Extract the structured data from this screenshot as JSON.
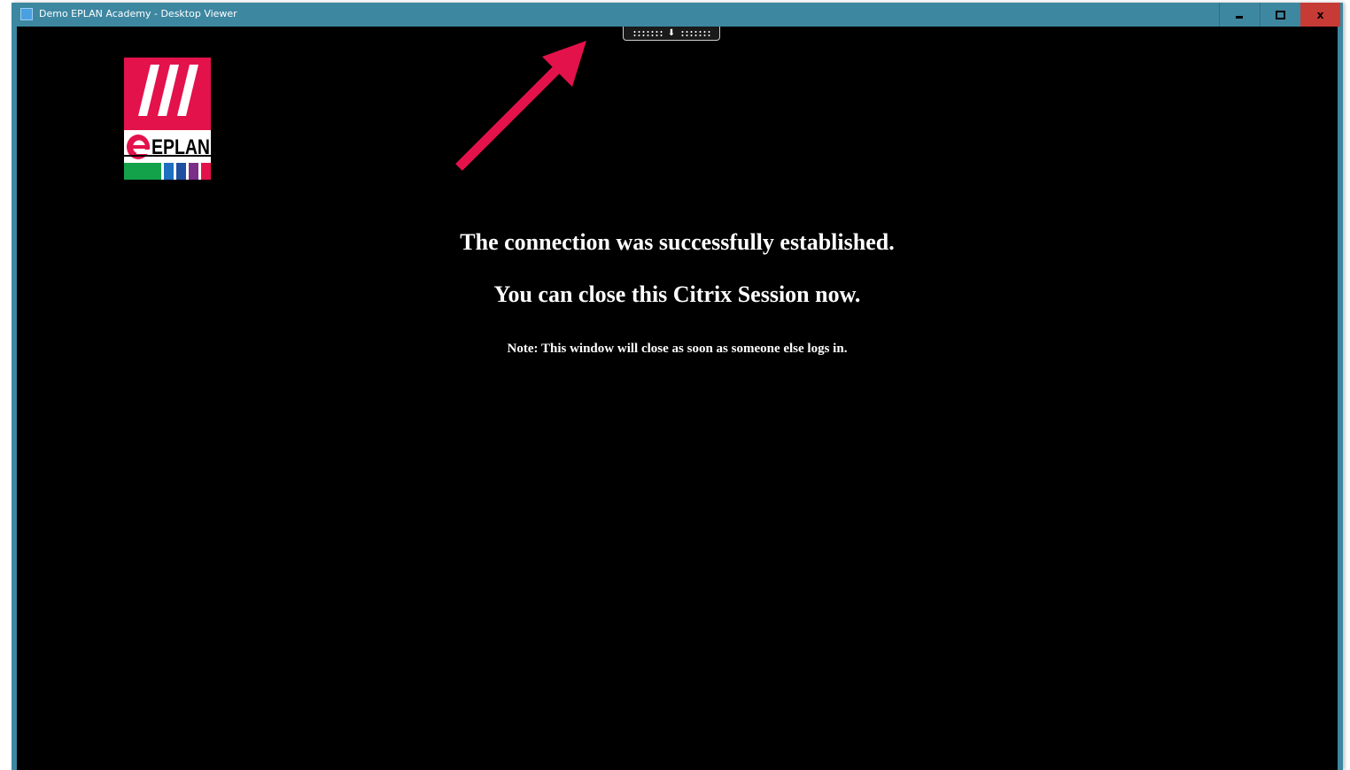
{
  "window": {
    "title": "Demo EPLAN Academy - Desktop Viewer",
    "buttons": {
      "minimize_icon": "minimize-icon",
      "maximize_icon": "maximize-icon",
      "close_label": "x"
    },
    "colors": {
      "titlebar": "#3d87a1",
      "close": "#c73b36",
      "desktop": "#000000"
    }
  },
  "citrix_toolbar": {
    "icon": "chevron-down-icon",
    "arrow_glyph": "⬇"
  },
  "logo": {
    "brand": "EPLAN",
    "colors": {
      "red": "#e3124b",
      "green": "#13a24a",
      "blue": "#1f6fc0",
      "purple": "#7a2e88"
    }
  },
  "message": {
    "line1": "The connection was successfully established.",
    "line2": "You can close this Citrix Session now.",
    "note": "Note: This window will close as soon as someone else logs in."
  },
  "annotation": {
    "arrow_color": "#e3124b"
  }
}
